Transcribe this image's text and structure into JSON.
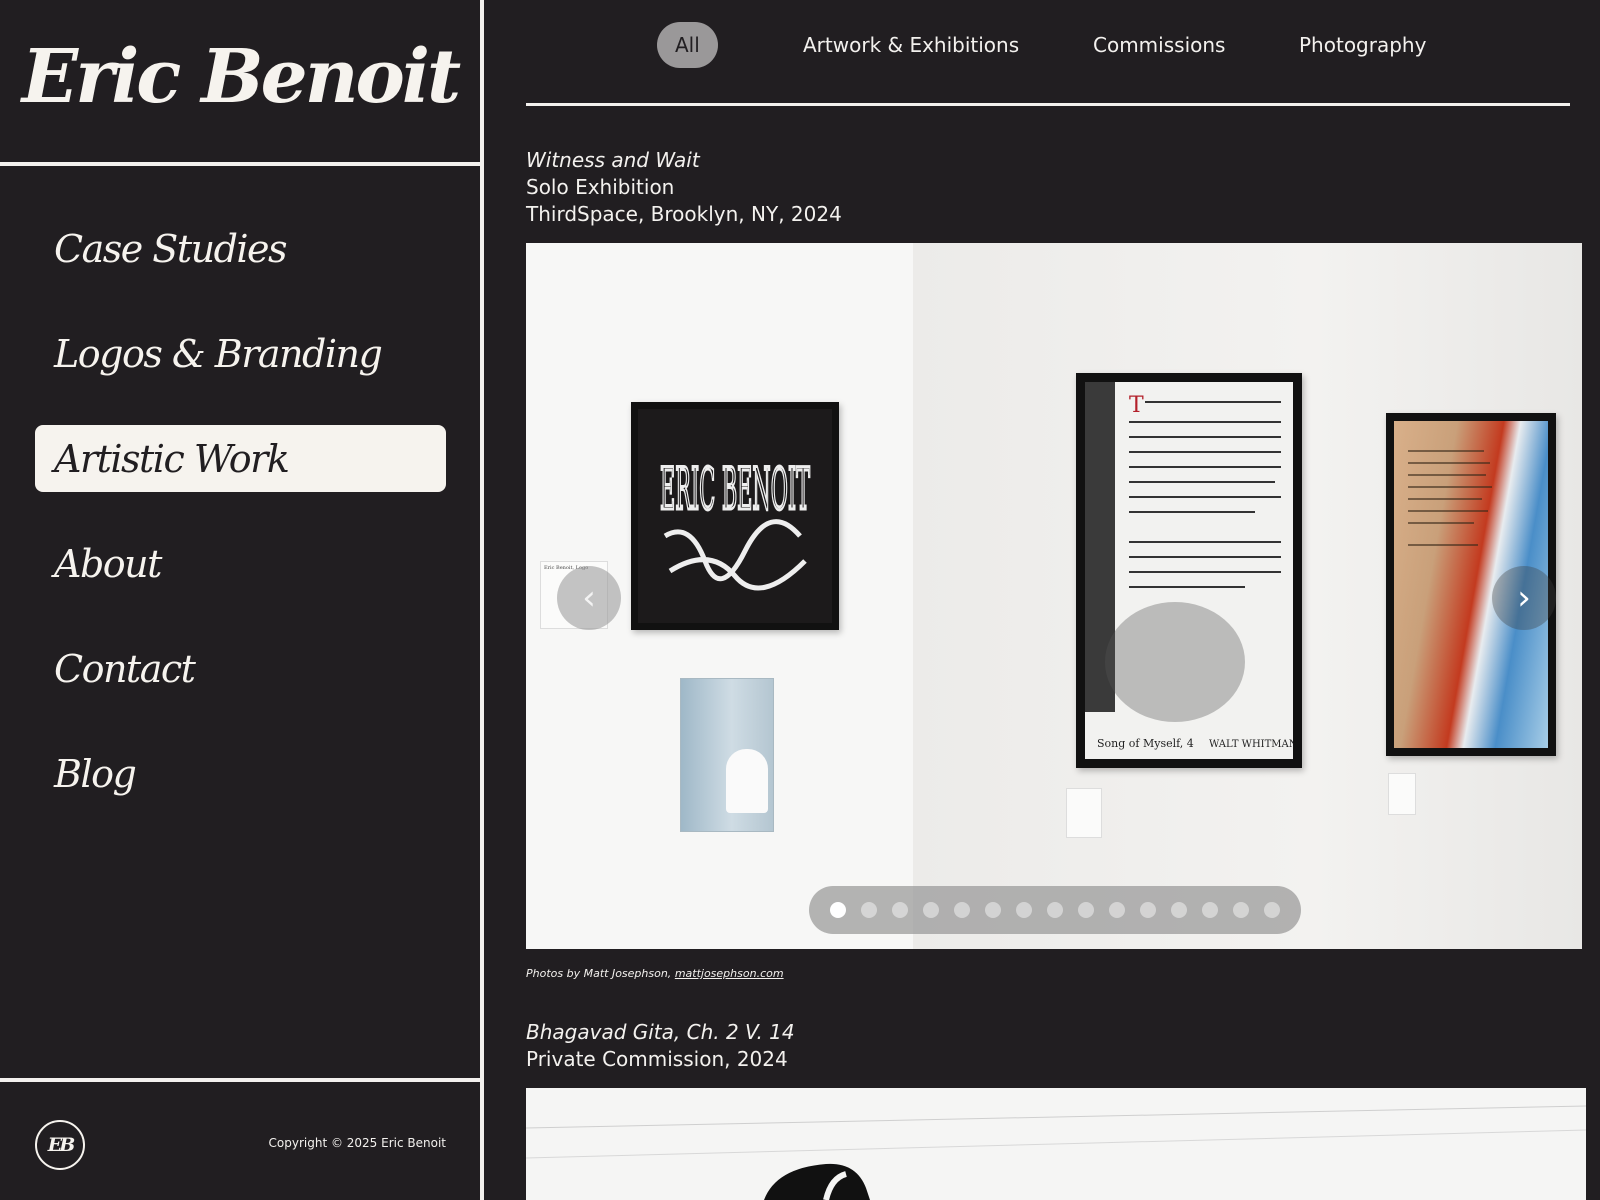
{
  "sidebar": {
    "brand": "Eric Benoit",
    "nav": [
      {
        "label": "Case Studies",
        "active": false
      },
      {
        "label": "Logos & Branding",
        "active": false
      },
      {
        "label": "Artistic Work",
        "active": true
      },
      {
        "label": "About",
        "active": false
      },
      {
        "label": "Contact",
        "active": false
      },
      {
        "label": "Blog",
        "active": false
      }
    ],
    "footer": {
      "logo": "EB",
      "copyright": "Copyright © 2025 Eric Benoit"
    }
  },
  "filters": [
    {
      "label": "All",
      "active": true
    },
    {
      "label": "Artwork & Exhibitions",
      "active": false
    },
    {
      "label": "Commissions",
      "active": false
    },
    {
      "label": "Photography",
      "active": false
    }
  ],
  "projects": [
    {
      "title": "Witness and Wait",
      "type": "Solo Exhibition",
      "location": "ThirdSpace, Brooklyn, NY, 2024",
      "carousel": {
        "slide_count": 15,
        "active_slide": 1,
        "prev_icon": "chevron-left-icon",
        "next_icon": "chevron-right-icon"
      },
      "credit_prefix": "Photos by Matt Josephson, ",
      "credit_link": "mattjosephson.com"
    },
    {
      "title": "Bhagavad Gita, Ch. 2 V. 14",
      "type": "Private Commission, 2024"
    }
  ],
  "artwork": {
    "poster_lettering": "ERIC BENOIT",
    "poster_footer_left": "Song of Myself, 4",
    "poster_footer_right": "WALT WHITMAN",
    "label_card_title": "Eric Benoit, Logo"
  },
  "colors": {
    "background": "#211e21",
    "text": "#f3f1ee",
    "active_pill": "#9a9899"
  }
}
